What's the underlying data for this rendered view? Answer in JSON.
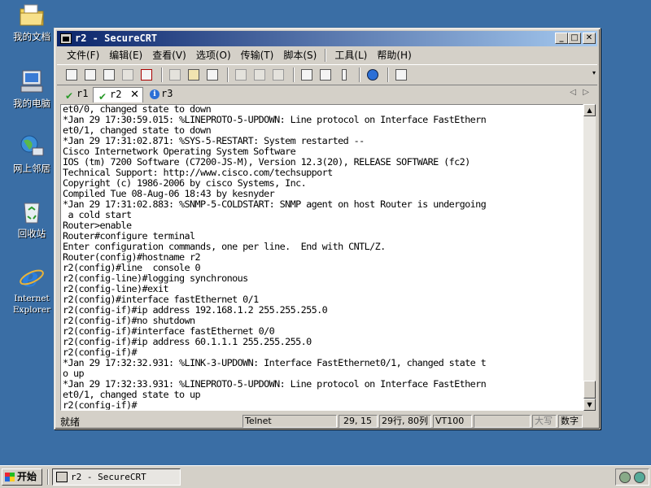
{
  "desktop": {
    "icons": [
      {
        "label": "我的文档",
        "icon": "my-documents-icon"
      },
      {
        "label": "我的电脑",
        "icon": "my-computer-icon"
      },
      {
        "label": "网上邻居",
        "icon": "network-places-icon"
      },
      {
        "label": "回收站",
        "icon": "recycle-bin-icon"
      },
      {
        "label": "Internet Explorer",
        "icon": "internet-explorer-icon"
      }
    ]
  },
  "window": {
    "title": "r2 - SecureCRT",
    "menu": [
      "文件(F)",
      "编辑(E)",
      "查看(V)",
      "选项(O)",
      "传输(T)",
      "脚本(S)",
      "工具(L)",
      "帮助(H)"
    ],
    "tabs": [
      {
        "label": "r1",
        "status": "connected"
      },
      {
        "label": "r2",
        "status": "connected",
        "active": true
      },
      {
        "label": "r3",
        "status": "info"
      }
    ],
    "close_glyph": "✕"
  },
  "terminal": {
    "lines": [
      "et0/0, changed state to down",
      "*Jan 29 17:30:59.015: %LINEPROTO-5-UPDOWN: Line protocol on Interface FastEthern",
      "et0/1, changed state to down",
      "*Jan 29 17:31:02.871: %SYS-5-RESTART: System restarted --",
      "Cisco Internetwork Operating System Software",
      "IOS (tm) 7200 Software (C7200-JS-M), Version 12.3(20), RELEASE SOFTWARE (fc2)",
      "Technical Support: http://www.cisco.com/techsupport",
      "Copyright (c) 1986-2006 by cisco Systems, Inc.",
      "Compiled Tue 08-Aug-06 18:43 by kesnyder",
      "*Jan 29 17:31:02.883: %SNMP-5-COLDSTART: SNMP agent on host Router is undergoing",
      " a cold start",
      "Router>enable",
      "Router#configure terminal",
      "Enter configuration commands, one per line.  End with CNTL/Z.",
      "Router(config)#hostname r2",
      "r2(config)#line  console 0",
      "r2(config-line)#logging synchronous",
      "r2(config-line)#exit",
      "r2(config)#interface fastEthernet 0/1",
      "r2(config-if)#ip address 192.168.1.2 255.255.255.0",
      "r2(config-if)#no shutdown",
      "r2(config-if)#interface fastEthernet 0/0",
      "r2(config-if)#ip address 60.1.1.1 255.255.255.0",
      "r2(config-if)#",
      "*Jan 29 17:32:32.931: %LINK-3-UPDOWN: Interface FastEthernet0/1, changed state t",
      "o up",
      "*Jan 29 17:32:33.931: %LINEPROTO-5-UPDOWN: Line protocol on Interface FastEthern",
      "et0/1, changed state to up",
      "r2(config-if)#"
    ]
  },
  "statusbar": {
    "status": "就绪",
    "protocol": "Telnet",
    "cursor": "29, 15",
    "size": "29行, 80列",
    "emulation": "VT100",
    "caps": "大写",
    "num": "数字"
  },
  "taskbar": {
    "start_label": "开始",
    "task_title": "r2 - SecureCRT"
  }
}
